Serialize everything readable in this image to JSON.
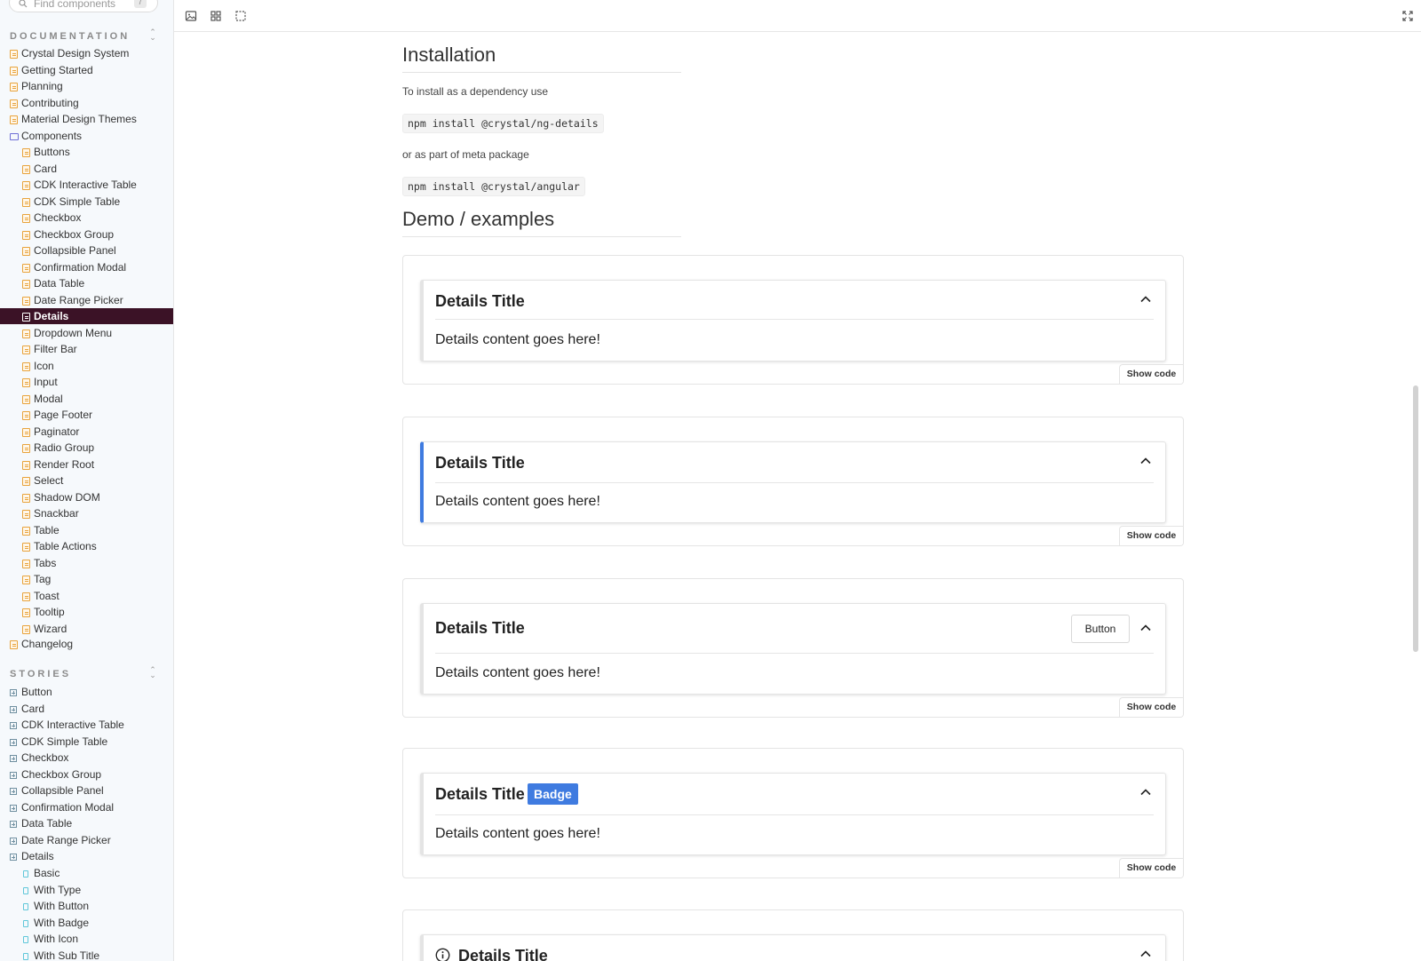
{
  "sidebar": {
    "search": {
      "placeholder": "Find components",
      "shortcut": "/"
    },
    "documentation_header": "DOCUMENTATION",
    "stories_header": "STORIES",
    "documentation_items": [
      "Crystal Design System",
      "Getting Started",
      "Planning",
      "Contributing",
      "Material Design Themes",
      "Components"
    ],
    "component_items": [
      "Buttons",
      "Card",
      "CDK Interactive Table",
      "CDK Simple Table",
      "Checkbox",
      "Checkbox Group",
      "Collapsible Panel",
      "Confirmation Modal",
      "Data Table",
      "Date Range Picker",
      "Details",
      "Dropdown Menu",
      "Filter Bar",
      "Icon",
      "Input",
      "Modal",
      "Page Footer",
      "Paginator",
      "Radio Group",
      "Render Root",
      "Select",
      "Shadow DOM",
      "Snackbar",
      "Table",
      "Table Actions",
      "Tabs",
      "Tag",
      "Toast",
      "Tooltip",
      "Wizard"
    ],
    "active_item": "Details",
    "changelog": "Changelog",
    "story_items": [
      "Button",
      "Card",
      "CDK Interactive Table",
      "CDK Simple Table",
      "Checkbox",
      "Checkbox Group",
      "Collapsible Panel",
      "Confirmation Modal",
      "Data Table",
      "Date Range Picker",
      "Details"
    ],
    "details_stories": [
      "Basic",
      "With Type",
      "With Button",
      "With Badge",
      "With Icon",
      "With Sub Title"
    ]
  },
  "toolbar": {
    "icons": [
      "image-icon",
      "grid-icon",
      "outline-icon",
      "fullscreen-icon"
    ]
  },
  "main": {
    "installation_heading": "Installation",
    "install_intro": "To install as a dependency use",
    "install_cmd_1": "npm install @crystal/ng-details",
    "meta_intro": "or as part of meta package",
    "install_cmd_2": "npm install @crystal/angular",
    "demo_heading": "Demo / examples",
    "show_code_label": "Show code",
    "demos": [
      {
        "title": "Details Title",
        "content": "Details content goes here!"
      },
      {
        "title": "Details Title",
        "content": "Details content goes here!"
      },
      {
        "title": "Details Title",
        "content": "Details content goes here!",
        "button": "Button"
      },
      {
        "title": "Details Title",
        "content": "Details content goes here!",
        "badge": "Badge"
      },
      {
        "title": "Details Title"
      }
    ]
  },
  "colors": {
    "active_bg": "#3b1226",
    "primary": "#3f7be0",
    "doc_icon": "#e8a33c"
  }
}
